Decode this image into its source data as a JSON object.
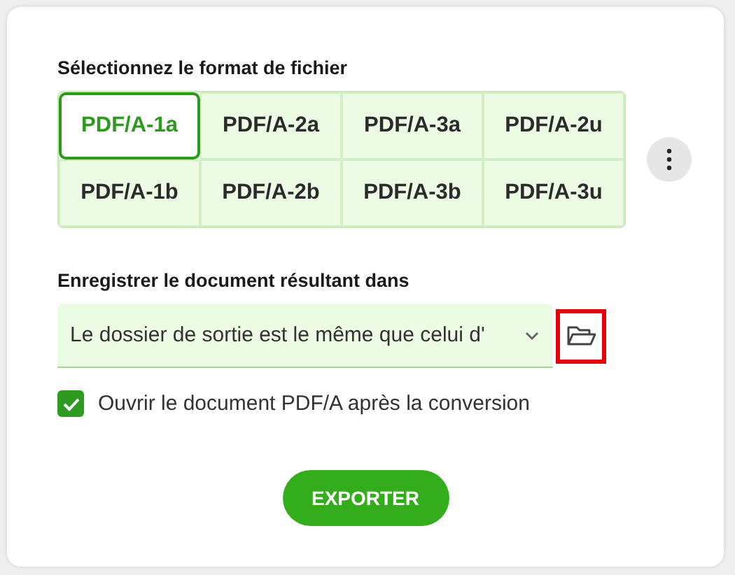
{
  "format_section": {
    "label": "Sélectionnez le format de fichier",
    "formats": [
      {
        "label": "PDF/A-1a",
        "selected": true
      },
      {
        "label": "PDF/A-2a",
        "selected": false
      },
      {
        "label": "PDF/A-3a",
        "selected": false
      },
      {
        "label": "PDF/A-2u",
        "selected": false
      },
      {
        "label": "PDF/A-1b",
        "selected": false
      },
      {
        "label": "PDF/A-2b",
        "selected": false
      },
      {
        "label": "PDF/A-3b",
        "selected": false
      },
      {
        "label": "PDF/A-3u",
        "selected": false
      }
    ]
  },
  "output_section": {
    "label": "Enregistrer le document résultant dans",
    "folder_value": "Le dossier de sortie est le même que celui d'",
    "browse_highlighted": true
  },
  "open_after": {
    "label": "Ouvrir le document PDF/A après la conversion",
    "checked": true
  },
  "export_button": "EXPORTER"
}
